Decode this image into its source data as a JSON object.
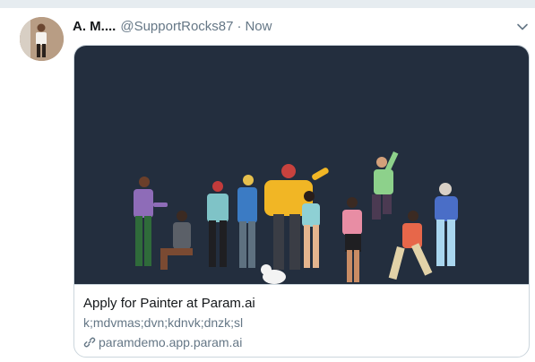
{
  "tweet": {
    "author_name": "A. M....",
    "handle": "@SupportRocks87",
    "separator": "·",
    "time": "Now",
    "avatar_icon": "user-avatar",
    "menu_icon": "chevron-down-icon"
  },
  "card": {
    "image_icon": "people-celebrating-illustration",
    "title": "Apply for Painter at Param.ai",
    "description": "k;mdvmas;dvn;kdnvk;dnzk;sl",
    "link_icon": "link-icon",
    "domain": "paramdemo.app.param.ai"
  },
  "colors": {
    "background": "#e6ecf0",
    "card_image_bg": "#232e3e",
    "muted_text": "#657786",
    "primary_text": "#14171a",
    "border": "#ccd6dd"
  }
}
